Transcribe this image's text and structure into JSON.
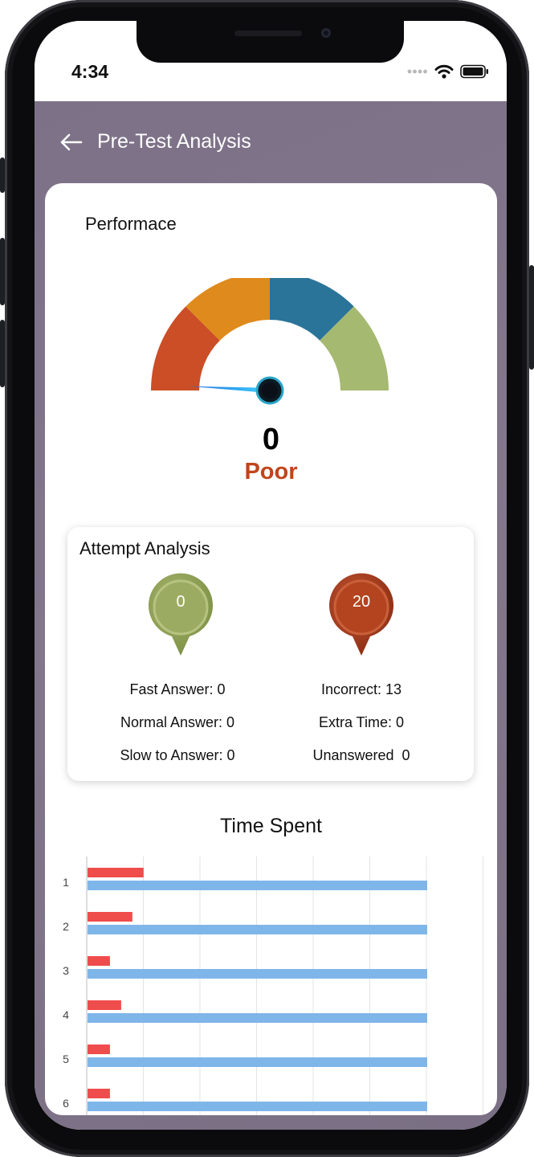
{
  "status_bar": {
    "time": "4:34"
  },
  "header": {
    "title": "Pre-Test Analysis"
  },
  "performance": {
    "title": "Performace",
    "score": "0",
    "rating": "Poor",
    "gauge_value": 0,
    "gauge_segments": [
      "#cb4e27",
      "#df8a1c",
      "#2b7499",
      "#a5b971"
    ]
  },
  "attempt_analysis": {
    "title": "Attempt Analysis",
    "left_badge": {
      "value": "0",
      "color": "#98a85f"
    },
    "right_badge": {
      "value": "20",
      "color": "#b14322"
    },
    "left_stats": [
      "Fast Answer: 0",
      "Normal Answer: 0",
      "Slow to Answer: 0"
    ],
    "right_stats": [
      "Incorrect: 13",
      "Extra Time: 0",
      "Unanswered  0"
    ]
  },
  "time_spent": {
    "title": "Time Spent"
  },
  "chart_data": {
    "type": "bar",
    "title": "Time Spent",
    "orientation": "horizontal",
    "categories": [
      "1",
      "2",
      "3",
      "4",
      "5",
      "6"
    ],
    "series": [
      {
        "values": [
          1.0,
          0.8,
          0.4,
          0.6,
          0.4,
          0.4
        ],
        "color": "#ef4c4c"
      },
      {
        "values": [
          6,
          6,
          6,
          6,
          6,
          6
        ],
        "color": "#7fb6ea"
      }
    ],
    "xlim": [
      0,
      7
    ],
    "grid": true
  }
}
